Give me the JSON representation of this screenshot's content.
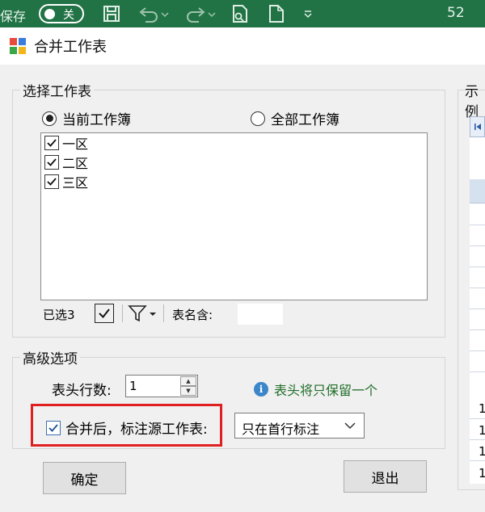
{
  "excel_titlebar": {
    "autosave_label": "保存",
    "autosave_state": "关",
    "sheet_count": "52",
    "icons": [
      "save-icon",
      "undo-icon",
      "redo-icon",
      "print-preview-icon",
      "new-file-icon",
      "customize-toolbar-icon"
    ]
  },
  "dialog": {
    "title": "合并工作表",
    "select_group": {
      "legend": "选择工作表",
      "radio_current": "当前工作簿",
      "radio_all": "全部工作簿",
      "selected_radio": "当前工作簿",
      "sheets": [
        {
          "label": "一区",
          "checked": true
        },
        {
          "label": "二区",
          "checked": true
        },
        {
          "label": "三区",
          "checked": true
        }
      ],
      "selected_count": "已选3",
      "name_filter_label": "表名含:"
    },
    "advanced_group": {
      "legend": "高级选项",
      "header_rows_label": "表头行数:",
      "header_rows_value": "1",
      "info_text": "表头将只保留一个",
      "mark_source_label": "合并后，标注源工作表:",
      "mark_source_checked": true,
      "mark_mode_value": "只在首行标注"
    },
    "buttons": {
      "ok": "确定",
      "exit": "退出"
    },
    "preview": {
      "legend": "示例",
      "row_values": [
        "1",
        "1",
        "1",
        "1"
      ]
    }
  },
  "colors": {
    "excel_green": "#217346",
    "highlight_red": "#e02020",
    "info_green": "#1f6e28"
  }
}
